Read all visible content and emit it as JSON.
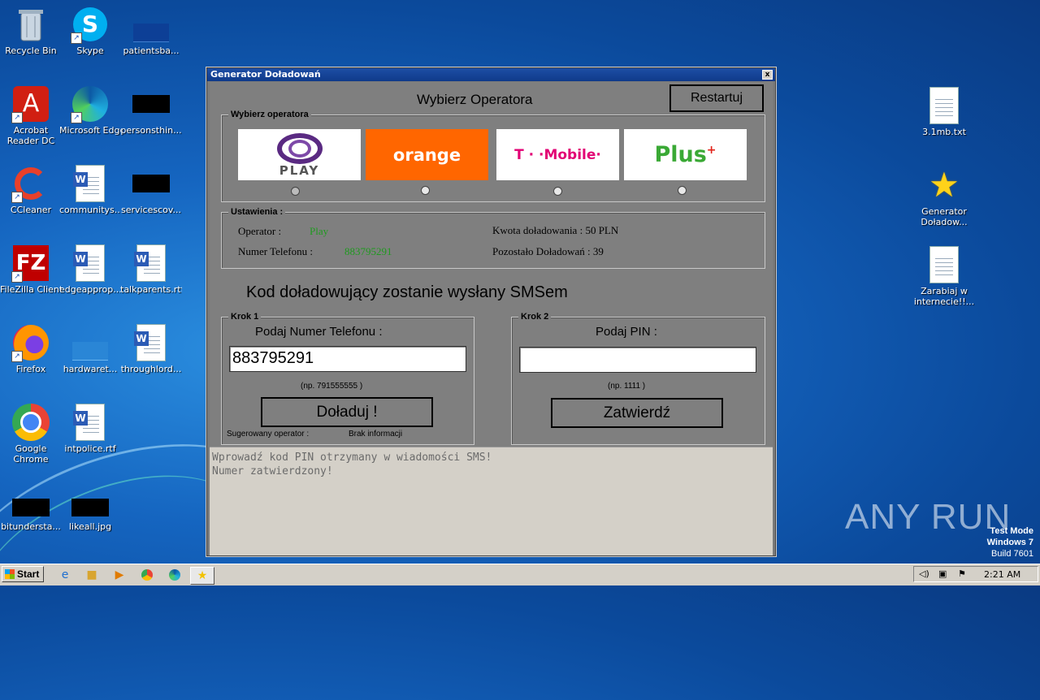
{
  "desktop_icons": {
    "recycle": "Recycle Bin",
    "skype": "Skype",
    "patients": "patientsba...",
    "acrobat": "Acrobat Reader DC",
    "edge": "Microsoft Edge",
    "persons": "personsthin...",
    "ccleaner": "CCleaner",
    "community": "communitys...",
    "services": "servicescov...",
    "filezilla": "FileZilla Client",
    "edgeapprop": "edgeapprop...",
    "talkparents": "talkparents.rtf",
    "firefox": "Firefox",
    "hardware": "hardwaret...",
    "throughlord": "throughlord...",
    "chrome": "Google Chrome",
    "intpolice": "intpolice.rtf",
    "bitunder": "bitundersta...",
    "likeall": "likeall.jpg",
    "txt": "3.1mb.txt",
    "generator": "Generator Doładow...",
    "zarabiaj": "Zarabiaj w internecie!!..."
  },
  "window": {
    "title": "Generator Doładowań",
    "close": "x",
    "heading": "Wybierz Operatora",
    "restart": "Restartuj",
    "operator_group": "Wybierz operatora",
    "operators": {
      "play": "PLAY",
      "orange": "orange",
      "tmobile": "T · ·Mobile·",
      "plus": "Plus"
    },
    "settings_group": "Ustawienia :",
    "operator_label": "Operator :",
    "operator_value": "Play",
    "phone_label": "Numer Telefonu :",
    "phone_value": "883795291",
    "amount": "Kwota doładowania : 50 PLN",
    "remaining": "Pozostało Doładowań :  39",
    "sms_heading": "Kod doładowujący zostanie wysłany SMSem",
    "step1": {
      "label": "Krok 1",
      "title": "Podaj Numer Telefonu :",
      "input_value": "883795291",
      "hint": "(np. 791555555 )",
      "button": "Doładuj !",
      "suggest_label": "Sugerowany operator :",
      "suggest_value": "Brak informacji"
    },
    "step2": {
      "label": "Krok 2",
      "title": "Podaj PIN :",
      "input_value": "",
      "hint": "(np. 1111 )",
      "button": "Zatwierdź"
    },
    "log": [
      "Wprowadź kod PIN otrzymany w wiadomości SMS!",
      "Numer zatwierdzony!"
    ]
  },
  "taskbar": {
    "start": "Start",
    "time": "2:21 AM"
  },
  "watermark": {
    "line1": "Test Mode",
    "line2": "Windows 7",
    "line3": "Build 7601",
    "brand": "ANY RUN"
  },
  "colors": {
    "window_bg": "#7f7f7f",
    "orange": "#ff6600",
    "plus_green": "#3aa935",
    "tmobile_pink": "#e20074",
    "play_purple": "#5a2a82"
  }
}
